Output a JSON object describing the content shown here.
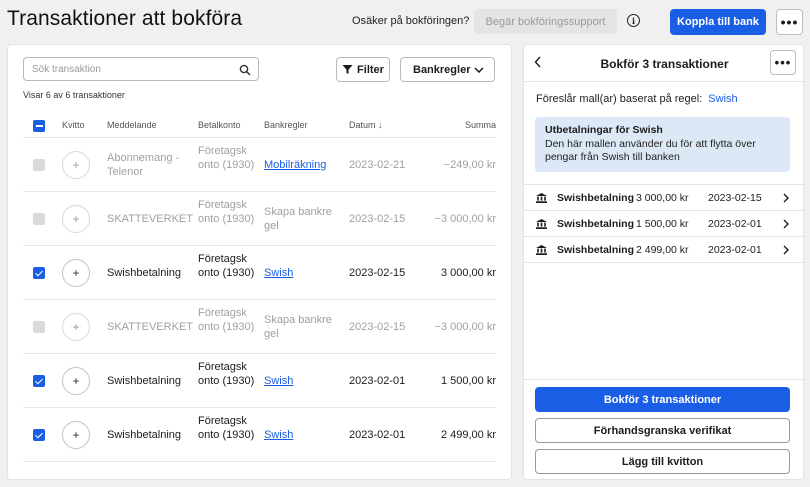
{
  "header": {
    "title": "Transaktioner att bokföra",
    "unsure_text": "Osäker på bokföringen?",
    "request_support_label": "Begär bokföringssupport",
    "connect_bank_label": "Koppla till bank",
    "more_label": "•••"
  },
  "toolbar": {
    "search_placeholder": "Sök transaktion",
    "filter_label": "Filter",
    "bankregler_label": "Bankregler",
    "count_text": "Visar 6 av 6 transaktioner"
  },
  "table": {
    "columns": {
      "kvitto": "Kvitto",
      "meddelande": "Meddelande",
      "betalkonto": "Betalkonto",
      "bankregler": "Bankregler",
      "datum": "Datum ↓",
      "summa": "Summa"
    },
    "rows": [
      {
        "checked": false,
        "disabled": true,
        "message": "Abonnemang - Telenor",
        "account": "Företagsk onto (1930)",
        "rule": "Mobilräkning",
        "rule_is_link": true,
        "date": "2023-02-21",
        "amount": "−249,00 kr"
      },
      {
        "checked": false,
        "disabled": true,
        "message": "SKATTEVERKET",
        "account": "Företagsk onto (1930)",
        "rule": "Skapa bankre gel",
        "rule_is_link": false,
        "date": "2023-02-15",
        "amount": "−3 000,00 kr"
      },
      {
        "checked": true,
        "disabled": false,
        "message": "Swishbetalning",
        "account": "Företagsk onto (1930)",
        "rule": "Swish",
        "rule_is_link": true,
        "date": "2023-02-15",
        "amount": "3 000,00 kr"
      },
      {
        "checked": false,
        "disabled": true,
        "message": "SKATTEVERKET",
        "account": "Företagsk onto (1930)",
        "rule": "Skapa bankre gel",
        "rule_is_link": false,
        "date": "2023-02-15",
        "amount": "−3 000,00 kr"
      },
      {
        "checked": true,
        "disabled": false,
        "message": "Swishbetalning",
        "account": "Företagsk onto (1930)",
        "rule": "Swish",
        "rule_is_link": true,
        "date": "2023-02-01",
        "amount": "1 500,00 kr"
      },
      {
        "checked": true,
        "disabled": false,
        "message": "Swishbetalning",
        "account": "Företagsk onto (1930)",
        "rule": "Swish",
        "rule_is_link": true,
        "date": "2023-02-01",
        "amount": "2 499,00 kr"
      }
    ]
  },
  "panel": {
    "title": "Bokför 3 transaktioner",
    "suggest_text": "Föreslår mall(ar) baserat på regel:",
    "suggest_rule": "Swish",
    "info_title": "Utbetalningar för Swish",
    "info_text": "Den här mallen använder du för att flytta över pengar från Swish till banken",
    "transactions": [
      {
        "name": "Swishbetalning",
        "amount": "3 000,00 kr",
        "date": "2023-02-15"
      },
      {
        "name": "Swishbetalning",
        "amount": "1 500,00 kr",
        "date": "2023-02-01"
      },
      {
        "name": "Swishbetalning",
        "amount": "2 499,00 kr",
        "date": "2023-02-01"
      }
    ],
    "primary_label": "Bokför 3 transaktioner",
    "preview_label": "Förhandsgranska verifikat",
    "add_receipt_label": "Lägg till kvitton",
    "more_label": "•••"
  },
  "colors": {
    "accent": "#1b5ee6",
    "info_bg": "#dde8f7",
    "disabled_text": "#a0a0a4"
  }
}
